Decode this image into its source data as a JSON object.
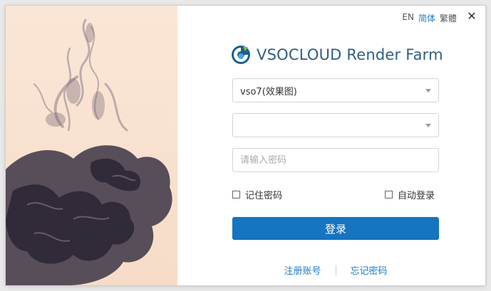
{
  "language_bar": {
    "en": "EN",
    "simplified": "简体",
    "traditional": "繁體",
    "active": "simplified"
  },
  "window": {
    "close_icon": "close-icon"
  },
  "brand": {
    "logo_icon": "vsocloud-logo-icon",
    "name": "VSOCLOUD Render Farm",
    "color": "#2e5e84"
  },
  "form": {
    "server_select": {
      "value": "vso7(效果图)"
    },
    "account_select": {
      "value": ""
    },
    "password": {
      "placeholder": "请输入密码",
      "value": ""
    },
    "remember_password": {
      "label": "记住密码",
      "checked": false
    },
    "auto_login": {
      "label": "自动登录",
      "checked": false
    },
    "login_button": {
      "label": "登录",
      "color": "#1674c0"
    }
  },
  "footer": {
    "register": "注册账号",
    "forgot_password": "忘记密码"
  }
}
